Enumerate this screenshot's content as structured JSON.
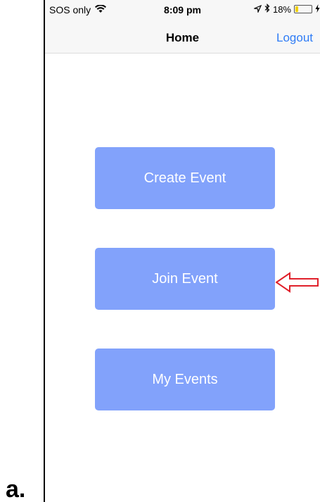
{
  "status_bar": {
    "carrier": "SOS only",
    "time": "8:09 pm",
    "battery_text": "18%",
    "battery_level": 0.18,
    "icons": [
      "wifi-icon",
      "location-arrow-icon",
      "bluetooth-icon",
      "battery-icon",
      "charging-icon"
    ]
  },
  "nav": {
    "title": "Home",
    "logout_label": "Logout"
  },
  "buttons": {
    "create_event": "Create Event",
    "join_event": "Join Event",
    "my_events": "My Events"
  },
  "figure_label": "a.",
  "colors": {
    "button_bg": "#82a2fb",
    "link": "#2f7cf6",
    "annotation_arrow": "#e0202a",
    "battery_fill": "#f2d000"
  }
}
